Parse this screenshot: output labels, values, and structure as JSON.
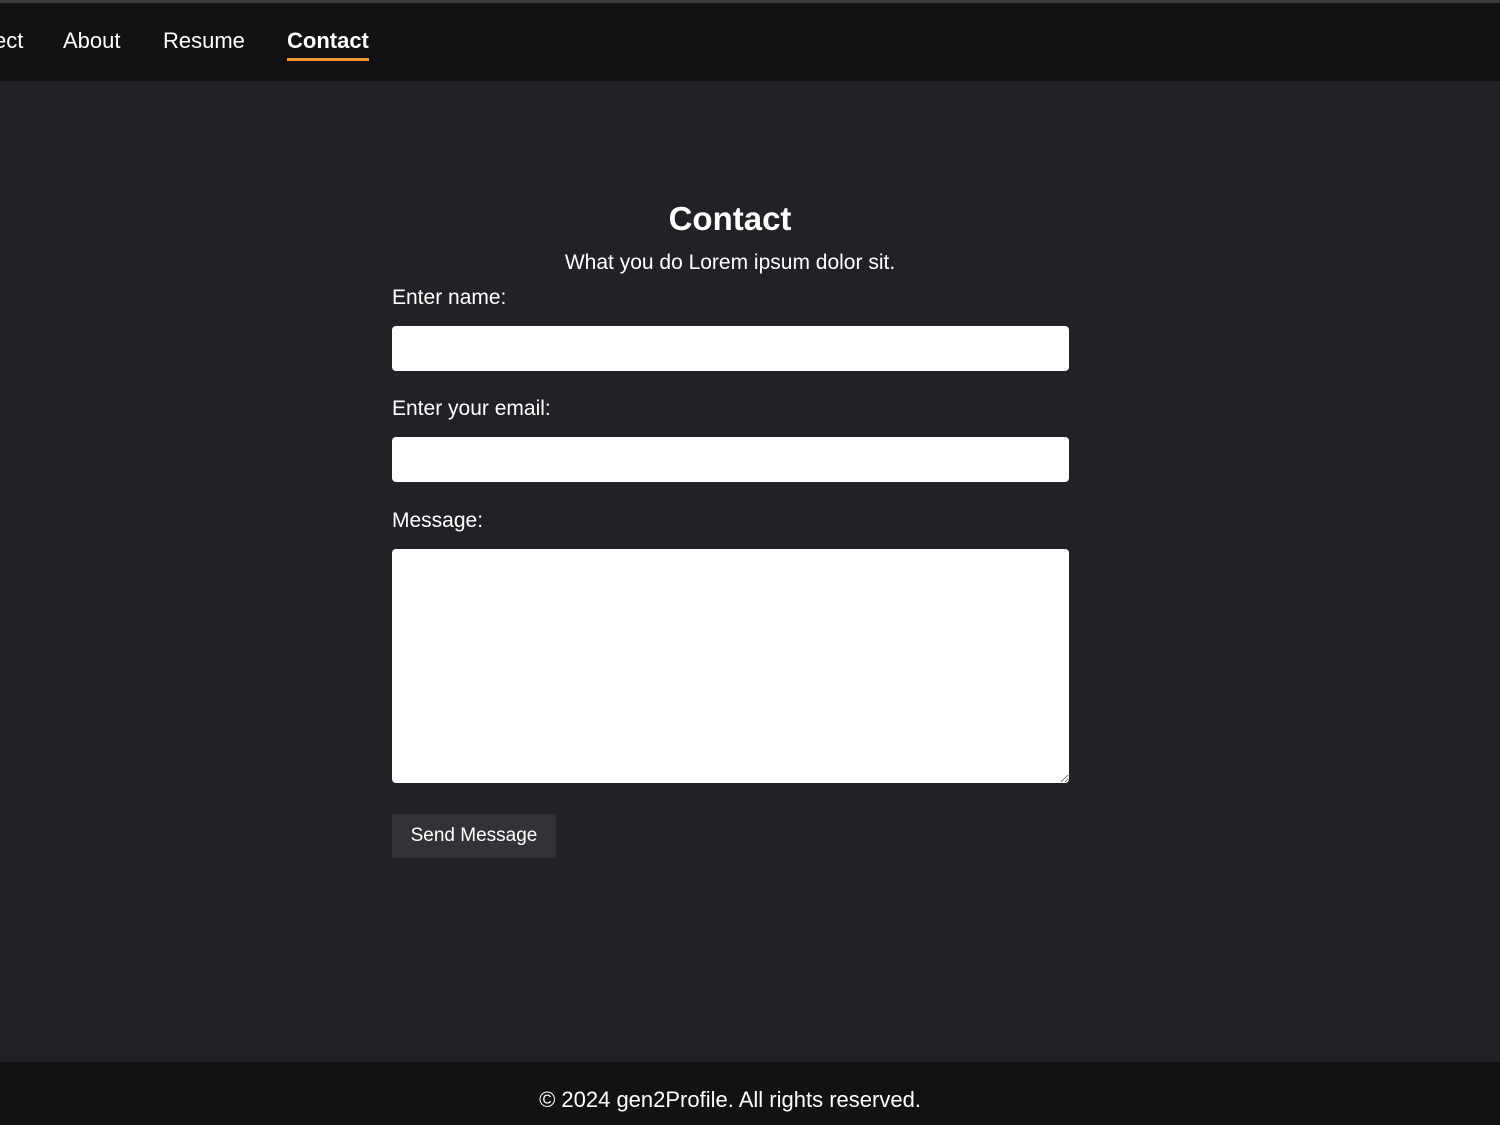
{
  "nav": {
    "items": [
      {
        "label": "ect"
      },
      {
        "label": "About"
      },
      {
        "label": "Resume"
      },
      {
        "label": "Contact",
        "active": true
      }
    ],
    "accent_color": "#f3962f"
  },
  "contact": {
    "title": "Contact",
    "subtitle": "What you do Lorem ipsum dolor sit.",
    "name_label": "Enter name:",
    "name_value": "",
    "email_label": "Enter your email:",
    "email_value": "",
    "message_label": "Message:",
    "message_value": "",
    "send_label": "Send Message"
  },
  "footer": {
    "text": "© 2024 gen2Profile. All rights reserved."
  }
}
